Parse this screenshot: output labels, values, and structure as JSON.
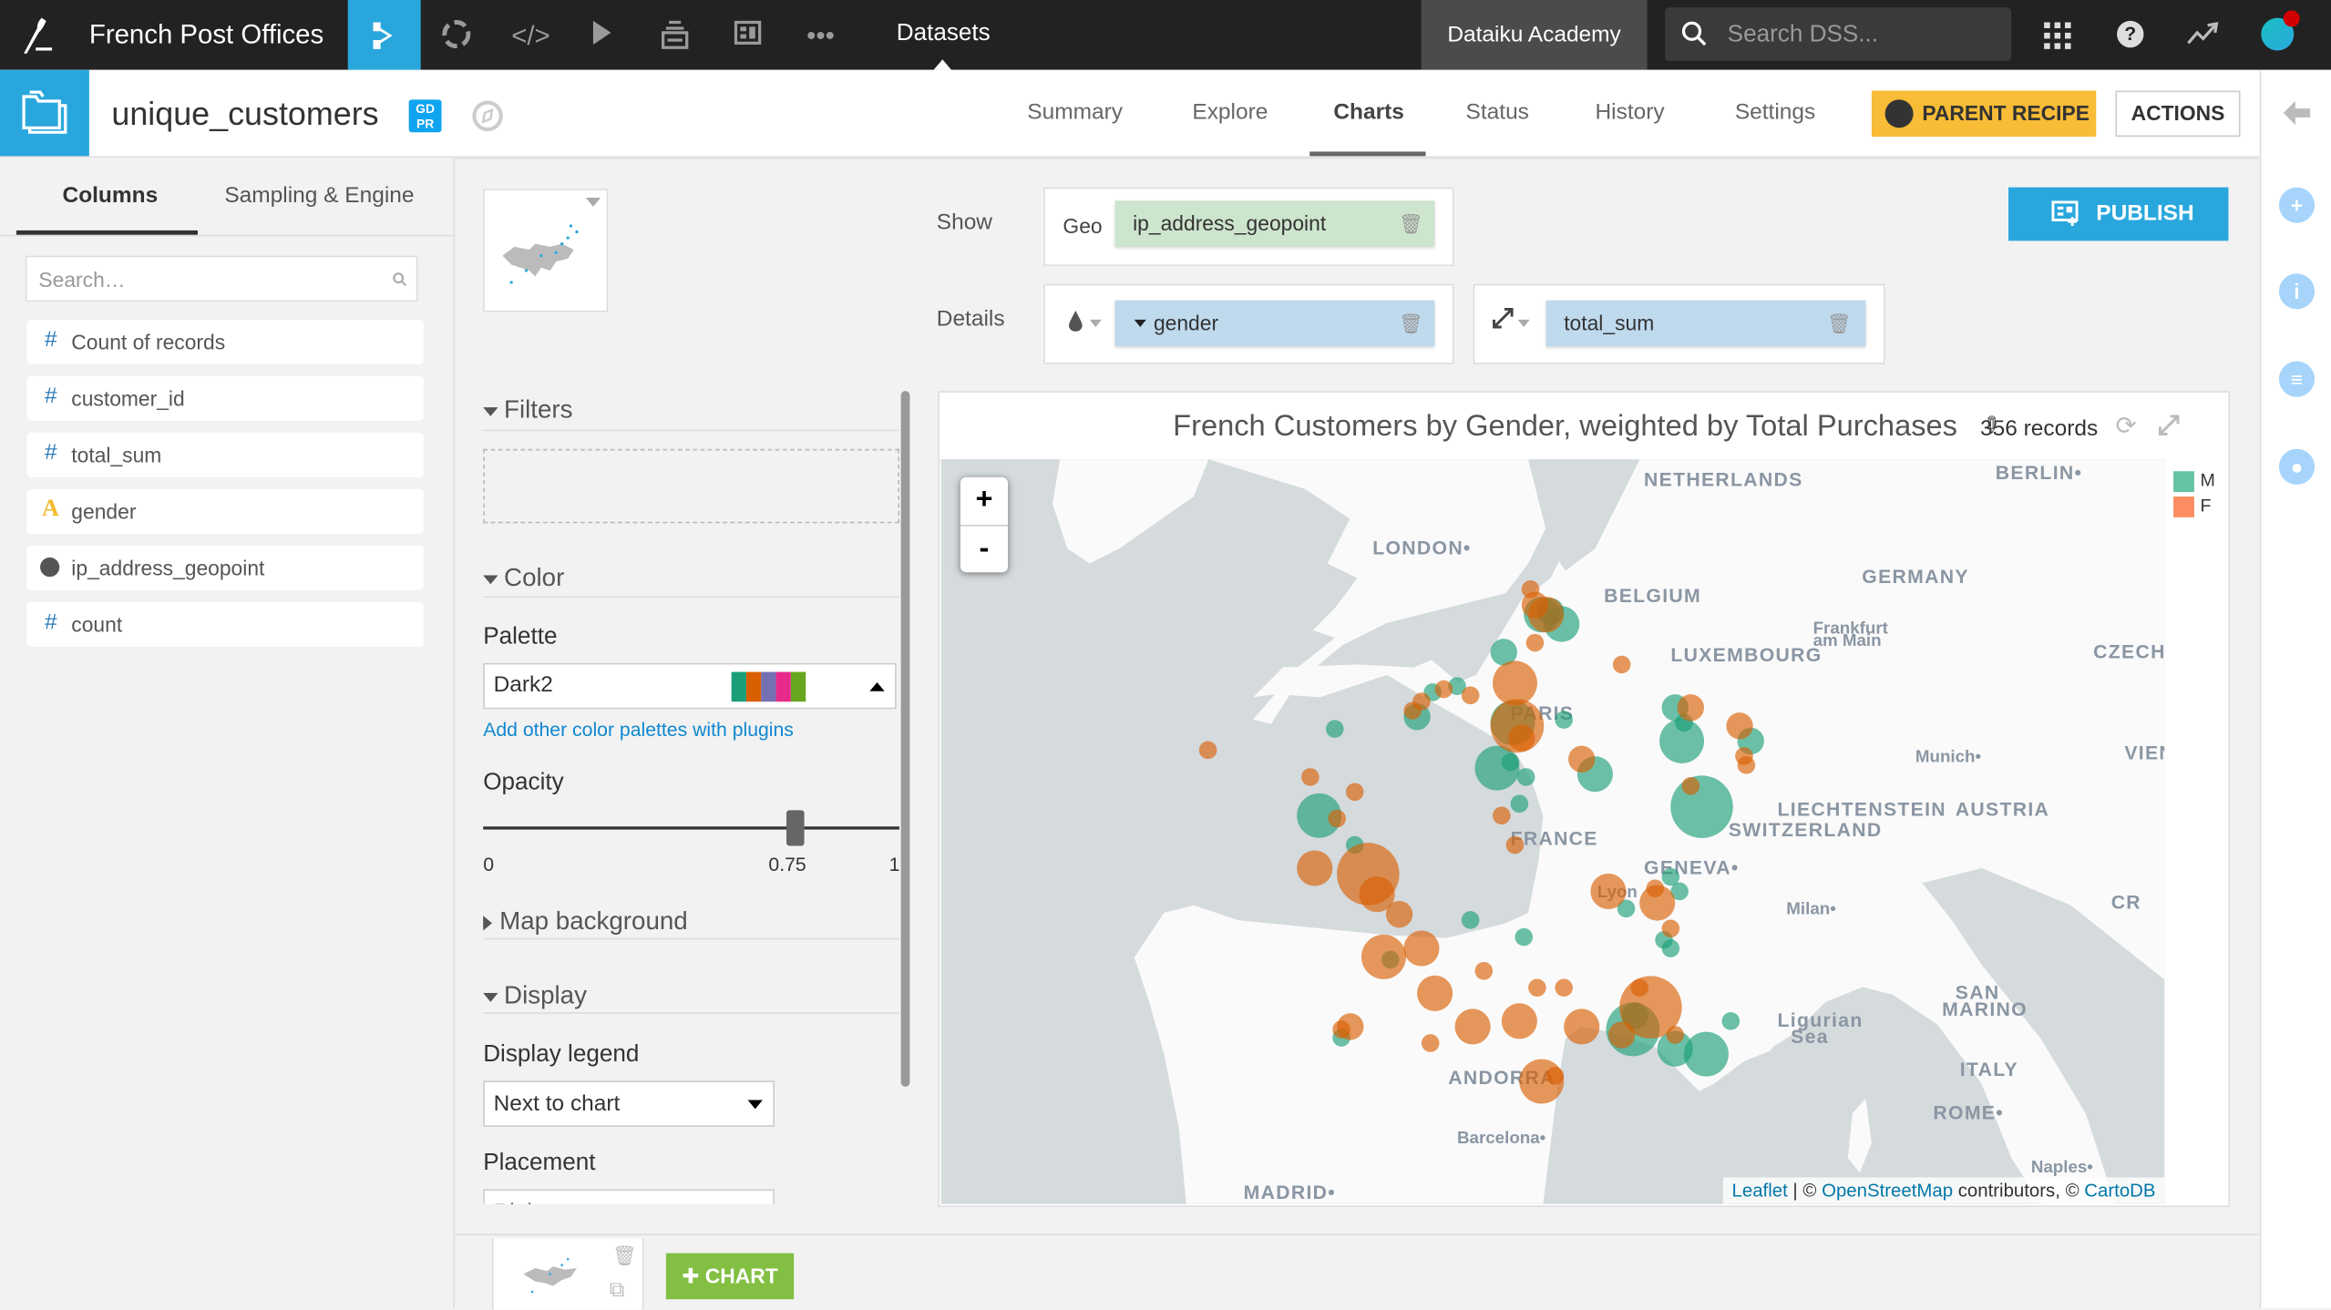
{
  "topbar": {
    "project_name": "French Post Offices",
    "nav_icons": [
      "flow-icon",
      "lab-icon",
      "code-icon",
      "jobs-icon",
      "deploy-icon",
      "dashboard-icon",
      "more-icon"
    ],
    "current_section": "Datasets",
    "instance_label": "Dataiku Academy",
    "search_placeholder": "Search DSS...",
    "right_icons": [
      "apps-grid-icon",
      "help-icon",
      "activity-icon",
      "user-avatar"
    ],
    "notification_color": "#d20000"
  },
  "header": {
    "dataset_name": "unique_customers",
    "gdpr_badge": "GD PR",
    "tabs": [
      {
        "label": "Summary",
        "active": false
      },
      {
        "label": "Explore",
        "active": false
      },
      {
        "label": "Charts",
        "active": true
      },
      {
        "label": "Status",
        "active": false
      },
      {
        "label": "History",
        "active": false
      },
      {
        "label": "Settings",
        "active": false
      }
    ],
    "parent_recipe_label": "PARENT RECIPE",
    "actions_label": "ACTIONS"
  },
  "sidebar": {
    "tabs": [
      {
        "label": "Columns",
        "active": true
      },
      {
        "label": "Sampling & Engine",
        "active": false
      }
    ],
    "search_placeholder": "Search…",
    "columns": [
      {
        "type_icon": "#",
        "type": "numeric",
        "name": "Count of records"
      },
      {
        "type_icon": "#",
        "type": "numeric",
        "name": "customer_id"
      },
      {
        "type_icon": "#",
        "type": "numeric",
        "name": "total_sum"
      },
      {
        "type_icon": "A",
        "type": "text",
        "name": "gender"
      },
      {
        "type_icon": "globe",
        "type": "geo",
        "name": "ip_address_geopoint"
      },
      {
        "type_icon": "#",
        "type": "numeric",
        "name": "count"
      }
    ]
  },
  "config": {
    "show_label": "Show",
    "details_label": "Details",
    "geo_label": "Geo",
    "geo_field": "ip_address_geopoint",
    "color_field": "gender",
    "size_field": "total_sum",
    "filters_title": "Filters",
    "color_title": "Color",
    "palette_label": "Palette",
    "palette_value": "Dark2",
    "palette_swatches": [
      "#1b9e77",
      "#d95f02",
      "#7570b3",
      "#e7298a",
      "#66a61e"
    ],
    "palette_plugins_link": "Add other color palettes with plugins",
    "opacity_label": "Opacity",
    "opacity_value": 0.75,
    "opacity_min": "0",
    "opacity_max": "1",
    "opacity_value_label": "0.75",
    "map_background_title": "Map background",
    "display_title": "Display",
    "display_legend_label": "Display legend",
    "display_legend_value": "Next to chart",
    "placement_label": "Placement",
    "placement_value": "Right",
    "publish_label": "PUBLISH"
  },
  "chart": {
    "title": "French Customers by Gender, weighted by Total Purchases",
    "records": "356 records",
    "zoom_in": "+",
    "zoom_out": "-",
    "attribution": {
      "leaflet": "Leaflet",
      "sep": " | © ",
      "osm": "OpenStreetMap",
      "contributors": " contributors, © ",
      "carto": "CartoDB"
    },
    "map_labels": [
      {
        "text": "LONDON•",
        "lon": -0.8,
        "lat": 51.55
      },
      {
        "text": "NETHERLANDS",
        "lon": 5.3,
        "lat": 52.6
      },
      {
        "text": "BERLIN•",
        "lon": 13.2,
        "lat": 52.7
      },
      {
        "text": "BELGIUM",
        "lon": 4.4,
        "lat": 50.8
      },
      {
        "text": "GERMANY",
        "lon": 10.2,
        "lat": 51.1
      },
      {
        "text": "LUXEMBOURG",
        "lon": 5.9,
        "lat": 49.85
      },
      {
        "text": "Frankfurt",
        "lon": 9.1,
        "lat": 50.3,
        "small": true
      },
      {
        "text": "am Main",
        "lon": 9.1,
        "lat": 50.1,
        "small": true
      },
      {
        "text": "CZECHIA",
        "lon": 15.4,
        "lat": 49.9
      },
      {
        "text": "PARIS",
        "lon": 2.3,
        "lat": 48.9
      },
      {
        "text": "Munich•",
        "lon": 11.4,
        "lat": 48.2,
        "small": true
      },
      {
        "text": "VIENNA•",
        "lon": 16.1,
        "lat": 48.25
      },
      {
        "text": "LIECHTENSTEIN",
        "lon": 8.3,
        "lat": 47.3
      },
      {
        "text": "AUSTRIA",
        "lon": 12.3,
        "lat": 47.3
      },
      {
        "text": "SWITZERLAND",
        "lon": 7.2,
        "lat": 46.95
      },
      {
        "text": "FRANCE",
        "lon": 2.3,
        "lat": 46.8
      },
      {
        "text": "GENEVA•",
        "lon": 5.3,
        "lat": 46.3
      },
      {
        "text": "Lyon",
        "lon": 4.25,
        "lat": 45.9,
        "small": true
      },
      {
        "text": "Milan•",
        "lon": 8.5,
        "lat": 45.6,
        "small": true
      },
      {
        "text": "CR",
        "lon": 15.8,
        "lat": 45.7
      },
      {
        "text": "SAN",
        "lon": 12.3,
        "lat": 44.1
      },
      {
        "text": "MARINO",
        "lon": 12.0,
        "lat": 43.8
      },
      {
        "text": "Ligurian",
        "lon": 8.3,
        "lat": 43.6
      },
      {
        "text": "Sea",
        "lon": 8.6,
        "lat": 43.3
      },
      {
        "text": "ITALY",
        "lon": 12.4,
        "lat": 42.7
      },
      {
        "text": "ANDORRA",
        "lon": 0.9,
        "lat": 42.55
      },
      {
        "text": "ROME•",
        "lon": 11.8,
        "lat": 41.9
      },
      {
        "text": "Barcelona•",
        "lon": 1.1,
        "lat": 41.45,
        "small": true
      },
      {
        "text": "Naples•",
        "lon": 14.0,
        "lat": 40.9,
        "small": true
      },
      {
        "text": "MADRID•",
        "lon": -3.7,
        "lat": 40.4
      }
    ]
  },
  "chart_data": {
    "type": "scatter",
    "subtype": "geo-bubble-map",
    "title": "French Customers by Gender, weighted by Total Purchases",
    "records": 356,
    "color_by": "gender",
    "size_by": "total_sum",
    "legend": [
      {
        "label": "M",
        "color": "#66c2a5"
      },
      {
        "label": "F",
        "color": "#fc8d62"
      }
    ],
    "legend_placement": "right",
    "opacity": 0.75,
    "series": [
      {
        "name": "M",
        "color": "#1b9e77",
        "points": [
          {
            "lon": 3.0,
            "lat": 50.6,
            "size": 3
          },
          {
            "lon": 3.2,
            "lat": 50.65,
            "size": 2
          },
          {
            "lon": 3.45,
            "lat": 50.45,
            "size": 3
          },
          {
            "lon": 2.15,
            "lat": 50.0,
            "size": 2
          },
          {
            "lon": 1.1,
            "lat": 49.45,
            "size": 1
          },
          {
            "lon": 0.55,
            "lat": 49.35,
            "size": 1
          },
          {
            "lon": 0.2,
            "lat": 48.95,
            "size": 2
          },
          {
            "lon": -1.65,
            "lat": 48.75,
            "size": 1
          },
          {
            "lon": 2.35,
            "lat": 48.85,
            "size": 4
          },
          {
            "lon": 3.5,
            "lat": 48.9,
            "size": 1
          },
          {
            "lon": 2.0,
            "lat": 48.1,
            "size": 4
          },
          {
            "lon": 2.3,
            "lat": 48.2,
            "size": 1
          },
          {
            "lon": 2.65,
            "lat": 47.95,
            "size": 1
          },
          {
            "lon": 2.5,
            "lat": 47.5,
            "size": 1
          },
          {
            "lon": 4.2,
            "lat": 48.0,
            "size": 3
          },
          {
            "lon": -2.0,
            "lat": 47.3,
            "size": 4
          },
          {
            "lon": -1.2,
            "lat": 46.8,
            "size": 1
          },
          {
            "lon": 6.0,
            "lat": 49.1,
            "size": 2
          },
          {
            "lon": 6.2,
            "lat": 48.85,
            "size": 1
          },
          {
            "lon": 6.15,
            "lat": 48.55,
            "size": 4
          },
          {
            "lon": 7.7,
            "lat": 48.55,
            "size": 2
          },
          {
            "lon": 6.6,
            "lat": 47.45,
            "size": 6
          },
          {
            "lon": 5.9,
            "lat": 46.25,
            "size": 1
          },
          {
            "lon": 6.1,
            "lat": 46.0,
            "size": 1
          },
          {
            "lon": 5.75,
            "lat": 45.15,
            "size": 1
          },
          {
            "lon": 5.9,
            "lat": 45.0,
            "size": 1
          },
          {
            "lon": 4.9,
            "lat": 45.7,
            "size": 1
          },
          {
            "lon": 2.6,
            "lat": 45.2,
            "size": 1
          },
          {
            "lon": 5.1,
            "lat": 43.8,
            "size": 2
          },
          {
            "lon": 5.05,
            "lat": 43.55,
            "size": 5
          },
          {
            "lon": 6.0,
            "lat": 43.2,
            "size": 3
          },
          {
            "lon": 6.7,
            "lat": 43.1,
            "size": 4
          },
          {
            "lon": 7.25,
            "lat": 43.7,
            "size": 1
          },
          {
            "lon": -1.5,
            "lat": 43.4,
            "size": 1
          },
          {
            "lon": -0.4,
            "lat": 44.8,
            "size": 1
          },
          {
            "lon": 1.4,
            "lat": 45.5,
            "size": 1
          }
        ]
      },
      {
        "name": "F",
        "color": "#d95f02",
        "points": [
          {
            "lon": 2.75,
            "lat": 51.0,
            "size": 1
          },
          {
            "lon": 2.85,
            "lat": 50.75,
            "size": 2
          },
          {
            "lon": 3.1,
            "lat": 50.6,
            "size": 3
          },
          {
            "lon": 2.85,
            "lat": 50.15,
            "size": 1
          },
          {
            "lon": 2.4,
            "lat": 49.5,
            "size": 4
          },
          {
            "lon": 0.8,
            "lat": 49.4,
            "size": 1
          },
          {
            "lon": 0.3,
            "lat": 49.2,
            "size": 1
          },
          {
            "lon": 0.1,
            "lat": 49.05,
            "size": 1
          },
          {
            "lon": 1.4,
            "lat": 49.3,
            "size": 1
          },
          {
            "lon": 2.45,
            "lat": 48.8,
            "size": 5
          },
          {
            "lon": 2.55,
            "lat": 48.6,
            "size": 2
          },
          {
            "lon": 3.9,
            "lat": 48.25,
            "size": 2
          },
          {
            "lon": 2.1,
            "lat": 47.3,
            "size": 1
          },
          {
            "lon": 2.4,
            "lat": 46.8,
            "size": 1
          },
          {
            "lon": -4.5,
            "lat": 48.4,
            "size": 1
          },
          {
            "lon": -2.2,
            "lat": 47.95,
            "size": 1
          },
          {
            "lon": -1.2,
            "lat": 47.7,
            "size": 1
          },
          {
            "lon": -1.6,
            "lat": 47.25,
            "size": 1
          },
          {
            "lon": -2.1,
            "lat": 46.4,
            "size": 3
          },
          {
            "lon": -0.9,
            "lat": 46.3,
            "size": 6
          },
          {
            "lon": -0.7,
            "lat": 45.95,
            "size": 3
          },
          {
            "lon": -0.2,
            "lat": 45.6,
            "size": 2
          },
          {
            "lon": 4.8,
            "lat": 49.8,
            "size": 1
          },
          {
            "lon": 6.35,
            "lat": 49.1,
            "size": 2
          },
          {
            "lon": 7.45,
            "lat": 48.8,
            "size": 2
          },
          {
            "lon": 7.55,
            "lat": 48.3,
            "size": 1
          },
          {
            "lon": 7.6,
            "lat": 48.15,
            "size": 1
          },
          {
            "lon": 6.35,
            "lat": 47.8,
            "size": 1
          },
          {
            "lon": 4.5,
            "lat": 46.0,
            "size": 3
          },
          {
            "lon": 5.55,
            "lat": 46.05,
            "size": 1
          },
          {
            "lon": 5.6,
            "lat": 45.8,
            "size": 3
          },
          {
            "lon": 5.9,
            "lat": 45.35,
            "size": 1
          },
          {
            "lon": 0.3,
            "lat": 45.0,
            "size": 3
          },
          {
            "lon": -0.55,
            "lat": 44.85,
            "size": 4
          },
          {
            "lon": 0.6,
            "lat": 44.2,
            "size": 3
          },
          {
            "lon": 1.7,
            "lat": 44.6,
            "size": 1
          },
          {
            "lon": 2.9,
            "lat": 44.3,
            "size": 1
          },
          {
            "lon": 2.5,
            "lat": 43.7,
            "size": 3
          },
          {
            "lon": 3.5,
            "lat": 44.3,
            "size": 1
          },
          {
            "lon": 3.9,
            "lat": 43.6,
            "size": 3
          },
          {
            "lon": 1.45,
            "lat": 43.6,
            "size": 3
          },
          {
            "lon": 0.5,
            "lat": 43.3,
            "size": 1
          },
          {
            "lon": -1.5,
            "lat": 43.55,
            "size": 1
          },
          {
            "lon": -1.3,
            "lat": 43.6,
            "size": 2
          },
          {
            "lon": 3.0,
            "lat": 42.6,
            "size": 4
          },
          {
            "lon": 3.3,
            "lat": 42.7,
            "size": 1
          },
          {
            "lon": 5.2,
            "lat": 44.3,
            "size": 1
          },
          {
            "lon": 5.45,
            "lat": 43.95,
            "size": 6
          },
          {
            "lon": 4.8,
            "lat": 43.45,
            "size": 2
          },
          {
            "lon": 6.0,
            "lat": 43.45,
            "size": 1
          }
        ]
      }
    ],
    "map_extent": {
      "lon": [
        -10.5,
        17.0
      ],
      "lat": [
        40.3,
        53.0
      ]
    }
  },
  "bottom": {
    "add_chart_label": "CHART"
  }
}
